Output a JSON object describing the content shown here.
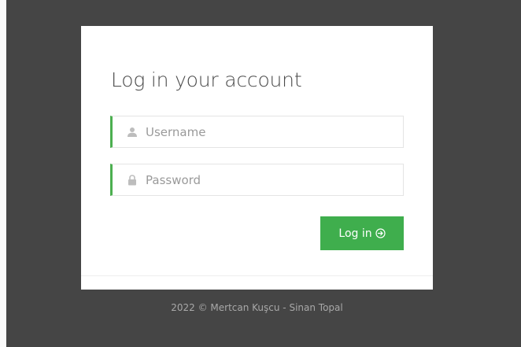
{
  "login": {
    "title": "Log in your account",
    "username": {
      "placeholder": "Username",
      "value": "",
      "icon": "user-icon"
    },
    "password": {
      "placeholder": "Password",
      "value": "",
      "icon": "lock-icon"
    },
    "submit": {
      "label": "Log in",
      "icon": "arrow-right-circle-icon"
    }
  },
  "footer": {
    "text": "2022 © Mertcan Kuşcu - Sinan Topal"
  },
  "colors": {
    "background": "#454545",
    "card": "#ffffff",
    "accent": "#3fae4d",
    "field_border_accent": "#4caf50",
    "title_text": "#4a4a4a",
    "footer_text": "#a8a8a8"
  }
}
